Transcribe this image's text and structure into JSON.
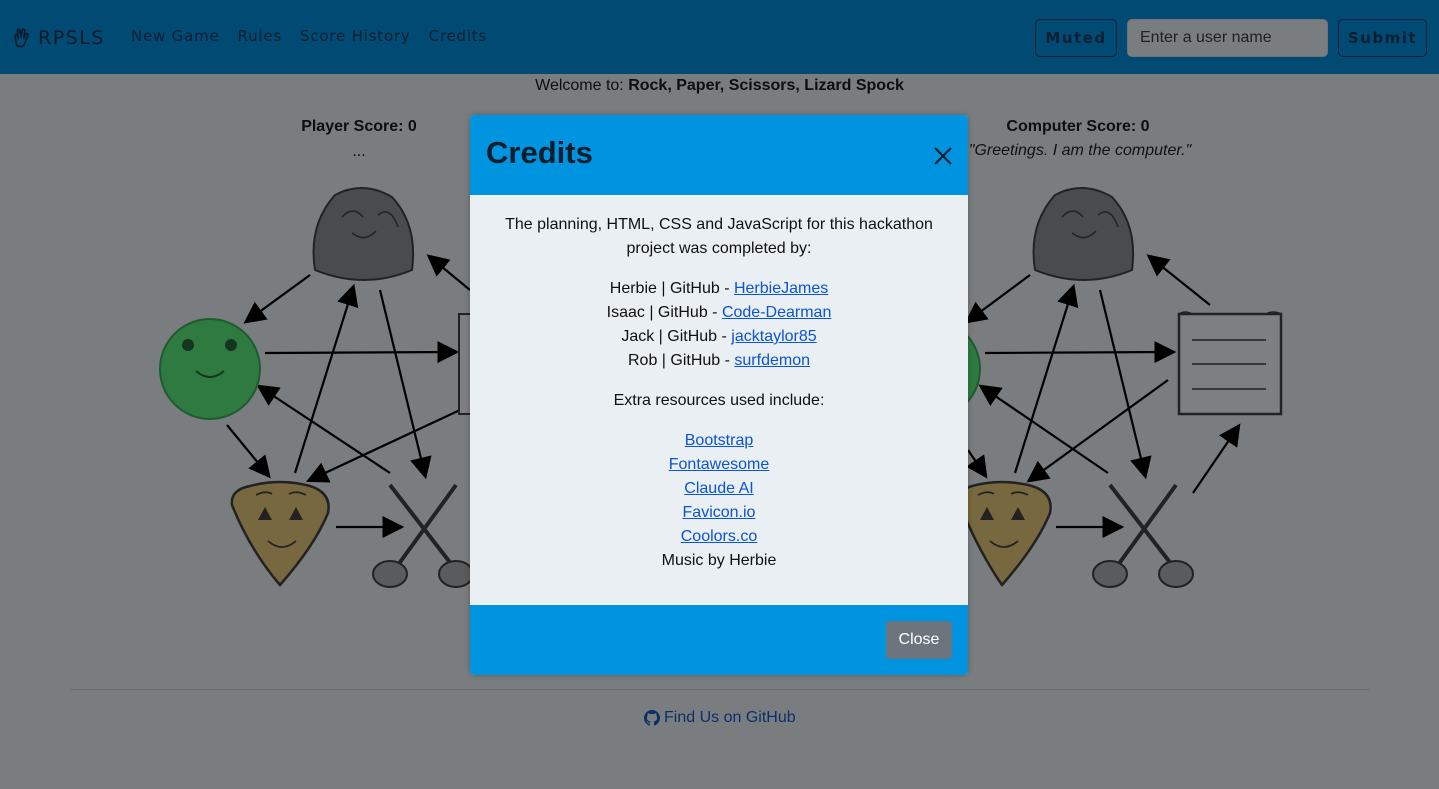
{
  "navbar": {
    "brand": "RPSLS",
    "links": [
      "New Game",
      "Rules",
      "Score History",
      "Credits"
    ],
    "muted_label": "Muted",
    "username_placeholder": "Enter a user name",
    "submit_label": "Submit"
  },
  "game": {
    "welcome_prefix": "Welcome to: ",
    "welcome_title": "Rock, Paper, Scissors, Lizard Spock",
    "player_score": "Player Score: 0",
    "player_message": "...",
    "computer_score": "Computer Score: 0",
    "computer_message": "\"Greetings. I am the computer.\""
  },
  "footer": {
    "github_label": "Find Us on GitHub"
  },
  "modal": {
    "title": "Credits",
    "intro": "The planning, HTML, CSS and JavaScript for this hackathon project was completed by:",
    "contributors": [
      {
        "prefix": "Herbie | GitHub - ",
        "handle": "HerbieJames"
      },
      {
        "prefix": "Isaac | GitHub - ",
        "handle": "Code-Dearman"
      },
      {
        "prefix": "Jack | GitHub - ",
        "handle": "jacktaylor85"
      },
      {
        "prefix": "Rob | GitHub - ",
        "handle": "surfdemon"
      }
    ],
    "extra_label": "Extra resources used include:",
    "resources": [
      "Bootstrap",
      "Fontawesome",
      "Claude AI",
      "Favicon.io",
      "Coolors.co"
    ],
    "music_credit": "Music by Herbie",
    "close_label": "Close"
  },
  "colors": {
    "navbar": "#004a74",
    "modal_header": "#0093e0",
    "modal_body": "#e9eff2",
    "overlay_background": "#7a7d80",
    "close_button": "#6c757d",
    "link": "#0b54d6"
  },
  "icons": [
    "hand-spock-icon",
    "close-icon",
    "github-icon"
  ]
}
